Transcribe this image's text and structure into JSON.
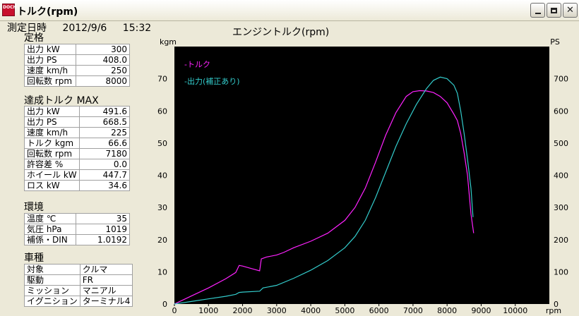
{
  "window": {
    "title": "トルク(rpm)",
    "icon_text": "DOCH"
  },
  "measurement": {
    "label": "測定日時",
    "date": "2012/9/6",
    "time": "15:32"
  },
  "rating": {
    "title": "定格",
    "rows": [
      {
        "label": "出力 kW",
        "value": "300"
      },
      {
        "label": "出力 PS",
        "value": "408.0"
      },
      {
        "label": "速度 km/h",
        "value": "250"
      },
      {
        "label": "回転数 rpm",
        "value": "8000"
      }
    ]
  },
  "achieved": {
    "title": "達成トルク MAX",
    "rows": [
      {
        "label": "出力 kW",
        "value": "491.6"
      },
      {
        "label": "出力 PS",
        "value": "668.5"
      },
      {
        "label": "速度 km/h",
        "value": "225"
      },
      {
        "label": "トルク kgm",
        "value": "66.6"
      },
      {
        "label": "回転数 rpm",
        "value": "7180"
      },
      {
        "label": "許容差 %",
        "value": "0.0"
      },
      {
        "label": "ホイール kW",
        "value": "447.7"
      },
      {
        "label": "ロス kW",
        "value": "34.6"
      }
    ]
  },
  "environment": {
    "title": "環境",
    "rows": [
      {
        "label": "温度 ℃",
        "value": "35"
      },
      {
        "label": "気圧 hPa",
        "value": "1019"
      },
      {
        "label": "補係・DIN",
        "value": "1.0192"
      }
    ]
  },
  "vehicle": {
    "title": "車種",
    "rows": [
      {
        "label": "対象",
        "value": "クルマ"
      },
      {
        "label": "駆動",
        "value": "FR"
      },
      {
        "label": "ミッション",
        "value": "マニアル"
      },
      {
        "label": "イグニション",
        "value": "ターミナル4"
      }
    ]
  },
  "colors": {
    "torque": "#ff22ff",
    "power": "#33cccc",
    "plot_bg": "#000000"
  },
  "chart_data": {
    "type": "line",
    "title": "エンジントルク(rpm)",
    "xlabel": "rpm",
    "ylabel_left": "kgm",
    "ylabel_right": "PS",
    "xlim": [
      0,
      11000
    ],
    "ylim_left": [
      0,
      80
    ],
    "ylim_right": [
      0,
      800
    ],
    "x_ticks": [
      0,
      1000,
      2000,
      3000,
      4000,
      5000,
      6000,
      7000,
      8000,
      9000,
      10000
    ],
    "y_ticks_left": [
      0,
      10,
      20,
      30,
      40,
      50,
      60,
      70
    ],
    "y_ticks_right": [
      0,
      100,
      200,
      300,
      400,
      500,
      600,
      700
    ],
    "grid": false,
    "legend_position": "top-left",
    "series": [
      {
        "name": "トルク",
        "axis": "left",
        "color": "#ff22ff",
        "x": [
          0,
          500,
          1000,
          1500,
          1800,
          1900,
          2000,
          2200,
          2500,
          2550,
          2700,
          3000,
          3200,
          3500,
          4000,
          4500,
          5000,
          5300,
          5600,
          5900,
          6200,
          6500,
          6800,
          7000,
          7200,
          7400,
          7600,
          7800,
          8000,
          8200,
          8300,
          8400,
          8500,
          8600,
          8700,
          8780
        ],
        "values": [
          0,
          2.5,
          5,
          7.8,
          9.8,
          12,
          11.8,
          11.2,
          10.3,
          14,
          14.6,
          15.2,
          16,
          17.5,
          19.5,
          22,
          26,
          30,
          36,
          44,
          52.5,
          59.5,
          64.5,
          66,
          66.3,
          66.2,
          65.7,
          64.5,
          62.5,
          59,
          57,
          53,
          47,
          40,
          28,
          22
        ]
      },
      {
        "name": "出力(補正あり)",
        "axis": "right",
        "color": "#33cccc",
        "x": [
          0,
          500,
          1000,
          1500,
          1800,
          1900,
          2000,
          2500,
          2600,
          2800,
          3000,
          3500,
          4000,
          4500,
          5000,
          5300,
          5600,
          5900,
          6200,
          6500,
          6800,
          7100,
          7400,
          7600,
          7800,
          8000,
          8200,
          8300,
          8400,
          8500,
          8600,
          8700,
          8760
        ],
        "values": [
          0,
          8,
          16,
          24,
          30,
          36,
          37,
          40,
          50,
          54,
          58,
          80,
          105,
          135,
          175,
          210,
          260,
          330,
          410,
          490,
          560,
          620,
          670,
          695,
          705,
          700,
          680,
          655,
          600,
          530,
          450,
          360,
          270
        ]
      }
    ]
  }
}
